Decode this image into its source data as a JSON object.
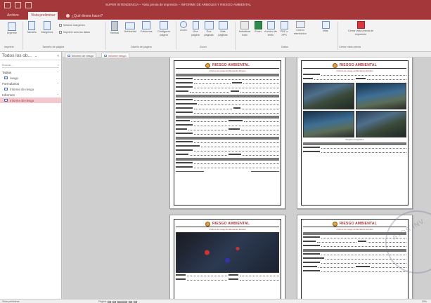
{
  "window": {
    "title": "SUPER INTENDENCIA – Vista previa de impresión – INFORME DE ARBOLES Y RIESGO AMBIENTAL",
    "accent": "#a4373a"
  },
  "tabs": [
    {
      "label": "Archivo"
    },
    {
      "label": "Vista preliminar"
    },
    {
      "label": "¿Qué desea hacer?"
    }
  ],
  "ribbon": {
    "print_label": "Imprimir",
    "size_label": "Tamaño",
    "margins_label": "Márgenes",
    "cb_margins": "Mostrar márgenes",
    "cb_data_only": "Imprimir solo los datos",
    "vertical_label": "Vertical",
    "horizontal_label": "Horizontal",
    "columns_label": "Columnas",
    "page_setup_label": "Configurar página",
    "zoom_label": "Zoom",
    "one_page_label": "Una página",
    "two_pages_label": "Dos páginas",
    "more_pages_label": "Más páginas",
    "refresh_label": "Actualizar todo",
    "excel_label": "Excel",
    "text_label": "Archivo de texto",
    "pdf_label": "PDF o XPS",
    "email_label": "Correo electrónico",
    "more_label": "Más",
    "close_label": "Cerrar vista previa de impresión",
    "group_print": "Imprimir",
    "group_size": "Tamaño de página",
    "group_layout": "Diseño de página",
    "group_zoom": "Zoom",
    "group_data": "Datos",
    "group_close": "Cerrar vista previa"
  },
  "nav": {
    "header": "Todos los ob...",
    "search_placeholder": "Buscar...",
    "groups": [
      {
        "label": "Tablas",
        "items": [
          {
            "label": "riesgo"
          }
        ]
      },
      {
        "label": "Formularios",
        "items": [
          {
            "label": "Informe de riesgo"
          }
        ]
      },
      {
        "label": "Informes",
        "items": [
          {
            "label": "Informe de riesgo",
            "selected": true
          }
        ]
      }
    ]
  },
  "doc_tabs": [
    {
      "label": "Informe de riesgo"
    },
    {
      "label": "Informe riesgo"
    }
  ],
  "report": {
    "banner": "RIESGO AMBIENTAL",
    "subtitle": "Informe de riesgo ambiental de árboles",
    "photo_caption": "Registro fotográfico"
  },
  "status": {
    "left": "Vista preliminar",
    "page_label": "Página",
    "page_value": "1",
    "zoom": "20%"
  },
  "stamp_text": "STOS INV"
}
